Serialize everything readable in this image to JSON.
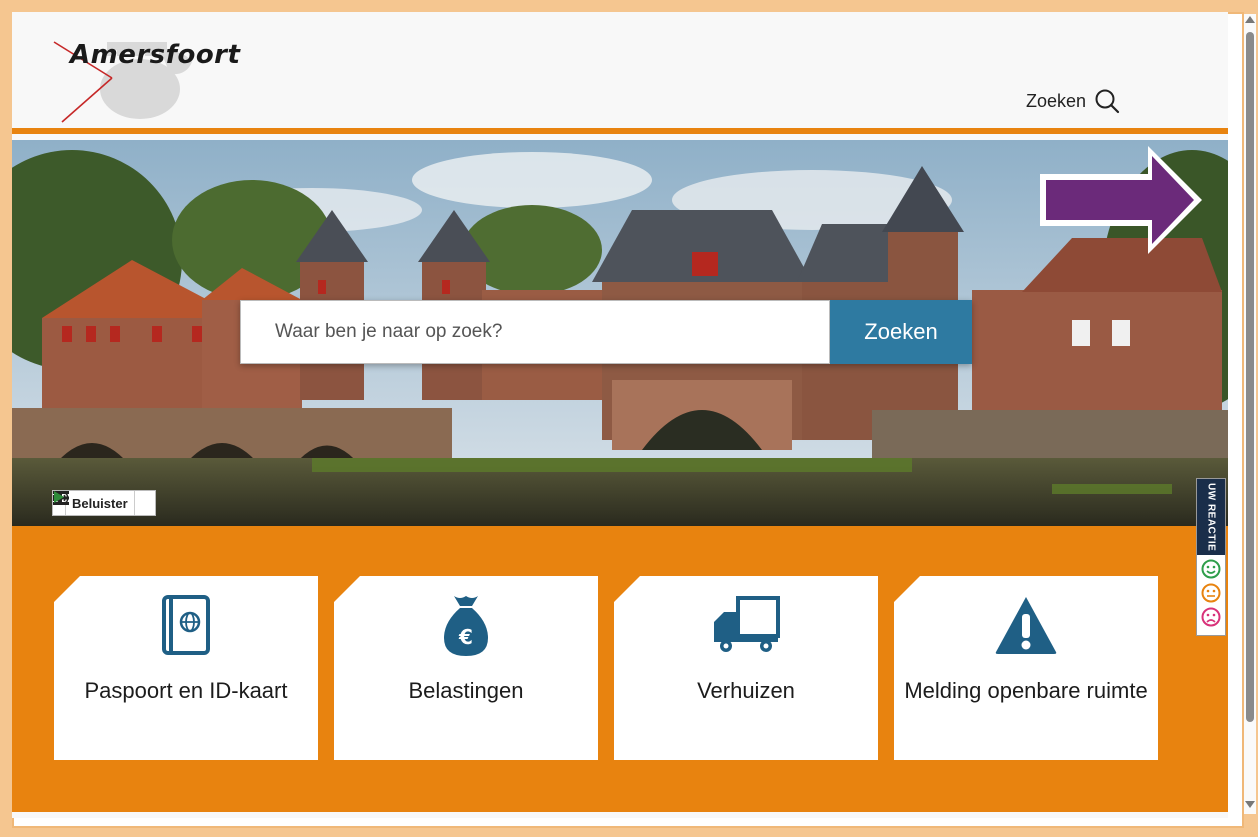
{
  "header": {
    "logo_text": "Amersfoort",
    "search_label": "Zoeken"
  },
  "hero": {
    "search_placeholder": "Waar ben je naar op zoek?",
    "search_button": "Zoeken"
  },
  "readspeaker": {
    "listen_label": "Beluister"
  },
  "tiles": [
    {
      "label": "Paspoort en ID-kaart",
      "icon": "passport-icon"
    },
    {
      "label": "Belastingen",
      "icon": "money-bag-icon"
    },
    {
      "label": "Verhuizen",
      "icon": "moving-truck-icon"
    },
    {
      "label": "Melding openbare ruimte",
      "icon": "warning-icon"
    }
  ],
  "feedback": {
    "label": "UW REACTIE",
    "faces": [
      "happy-face-icon",
      "neutral-face-icon",
      "sad-face-icon"
    ]
  },
  "colors": {
    "brand_orange": "#e8830f",
    "accent_blue": "#2e7aa1",
    "annotation_purple": "#6b2a7a"
  }
}
